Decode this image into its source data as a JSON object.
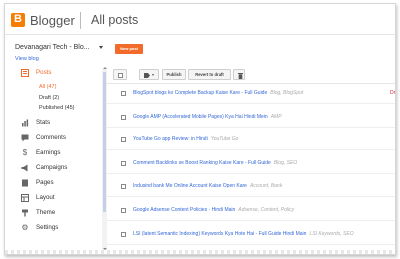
{
  "header": {
    "app_name": "Blogger",
    "page_title": "All posts"
  },
  "blog": {
    "name": "Devanagari Tech - Blo...",
    "view_blog": "View blog"
  },
  "new_post_label": "New post",
  "nav": {
    "posts": "Posts",
    "subitems": [
      "All (47)",
      "Draft (2)",
      "Published (45)"
    ],
    "items": [
      "Stats",
      "Comments",
      "Earnings",
      "Campaigns",
      "Pages",
      "Layout",
      "Theme",
      "Settings"
    ]
  },
  "toolbar": {
    "publish": "Publish",
    "revert": "Revert to draft"
  },
  "posts": [
    {
      "title": "BlogSpot blogs ko Complete Backup Kaise Kare - Full Guide",
      "labels": "Blog, BlogSpot",
      "status": "Dr"
    },
    {
      "title": "Google AMP (Accelerated Mobile Pages) Kya Hai Hindi Mein",
      "labels": "AMP",
      "status": ""
    },
    {
      "title": "YouTube Go app Review: in Hindi",
      "labels": "YouTube Go",
      "status": ""
    },
    {
      "title": "Comment Backlinks se Boost Ranking Kaise Kare - Full Guide",
      "labels": "Blog, SEO",
      "status": ""
    },
    {
      "title": "Indusind bank Me Online Account Kaise Open Kare",
      "labels": "Account, Bank",
      "status": ""
    },
    {
      "title": "Google Adsense Content Policies - Hindi Main",
      "labels": "Adsense, Content, Policy",
      "status": ""
    },
    {
      "title": "LSI (latent Semantic Indexing) Keywords Kya Hote Hai - Full Guide Hindi Main",
      "labels": "LSI Keywords, SEO",
      "status": ""
    }
  ]
}
